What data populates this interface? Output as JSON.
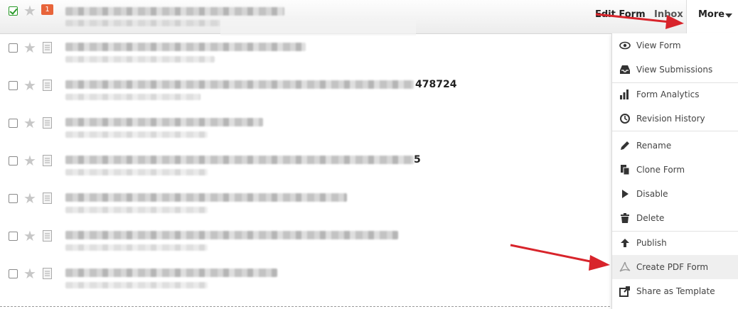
{
  "header": {
    "badge_count": "1",
    "edit_form_label": "Edit Form",
    "inbox_label": "Inbox",
    "more_label": "More"
  },
  "forms": [
    {
      "tail": ""
    },
    {
      "tail": ""
    },
    {
      "tail": "478724"
    },
    {
      "tail": ""
    },
    {
      "tail": "5"
    },
    {
      "tail": ""
    },
    {
      "tail": ""
    },
    {
      "tail": ""
    }
  ],
  "menu": {
    "items": [
      {
        "label": "View Form",
        "icon": "eye-icon"
      },
      {
        "label": "View Submissions",
        "icon": "inbox-icon"
      },
      {
        "label": "Form Analytics",
        "icon": "bar-chart-icon"
      },
      {
        "label": "Revision History",
        "icon": "history-icon"
      },
      {
        "label": "Rename",
        "icon": "pencil-icon"
      },
      {
        "label": "Clone Form",
        "icon": "copy-icon"
      },
      {
        "label": "Disable",
        "icon": "play-icon"
      },
      {
        "label": "Delete",
        "icon": "trash-icon"
      },
      {
        "label": "Publish",
        "icon": "upload-icon"
      },
      {
        "label": "Create PDF Form",
        "icon": "pdf-icon"
      },
      {
        "label": "Share as Template",
        "icon": "share-icon"
      }
    ]
  },
  "colors": {
    "accent_arrow": "#d8242b",
    "badge": "#e8643a",
    "check": "#2a9a2a"
  }
}
